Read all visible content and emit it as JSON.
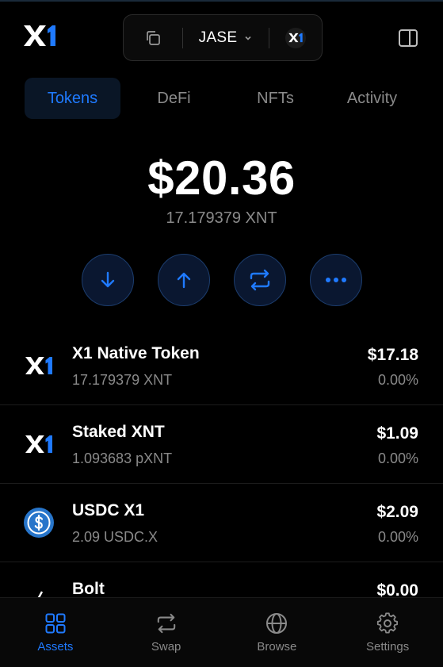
{
  "header": {
    "logo_text": "X1",
    "account_name": "JASE",
    "network_label": "X1"
  },
  "tabs": [
    {
      "label": "Tokens",
      "active": true
    },
    {
      "label": "DeFi",
      "active": false
    },
    {
      "label": "NFTs",
      "active": false
    },
    {
      "label": "Activity",
      "active": false
    }
  ],
  "balance": {
    "usd": "$20.36",
    "native": "17.179379 XNT"
  },
  "actions": [
    {
      "name": "receive",
      "icon": "arrow-down-icon"
    },
    {
      "name": "send",
      "icon": "arrow-up-icon"
    },
    {
      "name": "swap",
      "icon": "swap-icon"
    },
    {
      "name": "more",
      "icon": "more-icon"
    }
  ],
  "tokens": [
    {
      "name": "X1 Native Token",
      "amount": "17.179379 XNT",
      "value": "$17.18",
      "change": "0.00%",
      "icon": "x1-logo-icon"
    },
    {
      "name": "Staked XNT",
      "amount": "1.093683 pXNT",
      "value": "$1.09",
      "change": "0.00%",
      "icon": "x1-logo-icon"
    },
    {
      "name": "USDC X1",
      "amount": "2.09 USDC.X",
      "value": "$2.09",
      "change": "0.00%",
      "icon": "usdc-icon"
    },
    {
      "name": "Bolt",
      "amount": "",
      "value": "$0.00",
      "change": "",
      "icon": "bolt-icon"
    }
  ],
  "bottom_nav": [
    {
      "label": "Assets",
      "icon": "grid-icon",
      "active": true
    },
    {
      "label": "Swap",
      "icon": "swap-icon",
      "active": false
    },
    {
      "label": "Browse",
      "icon": "globe-icon",
      "active": false
    },
    {
      "label": "Settings",
      "icon": "gear-icon",
      "active": false
    }
  ],
  "colors": {
    "accent": "#1f7aff",
    "background": "#000000",
    "muted_text": "#8a8a8a",
    "action_button_bg": "#0a1730",
    "usdc_blue": "#2775ca"
  }
}
